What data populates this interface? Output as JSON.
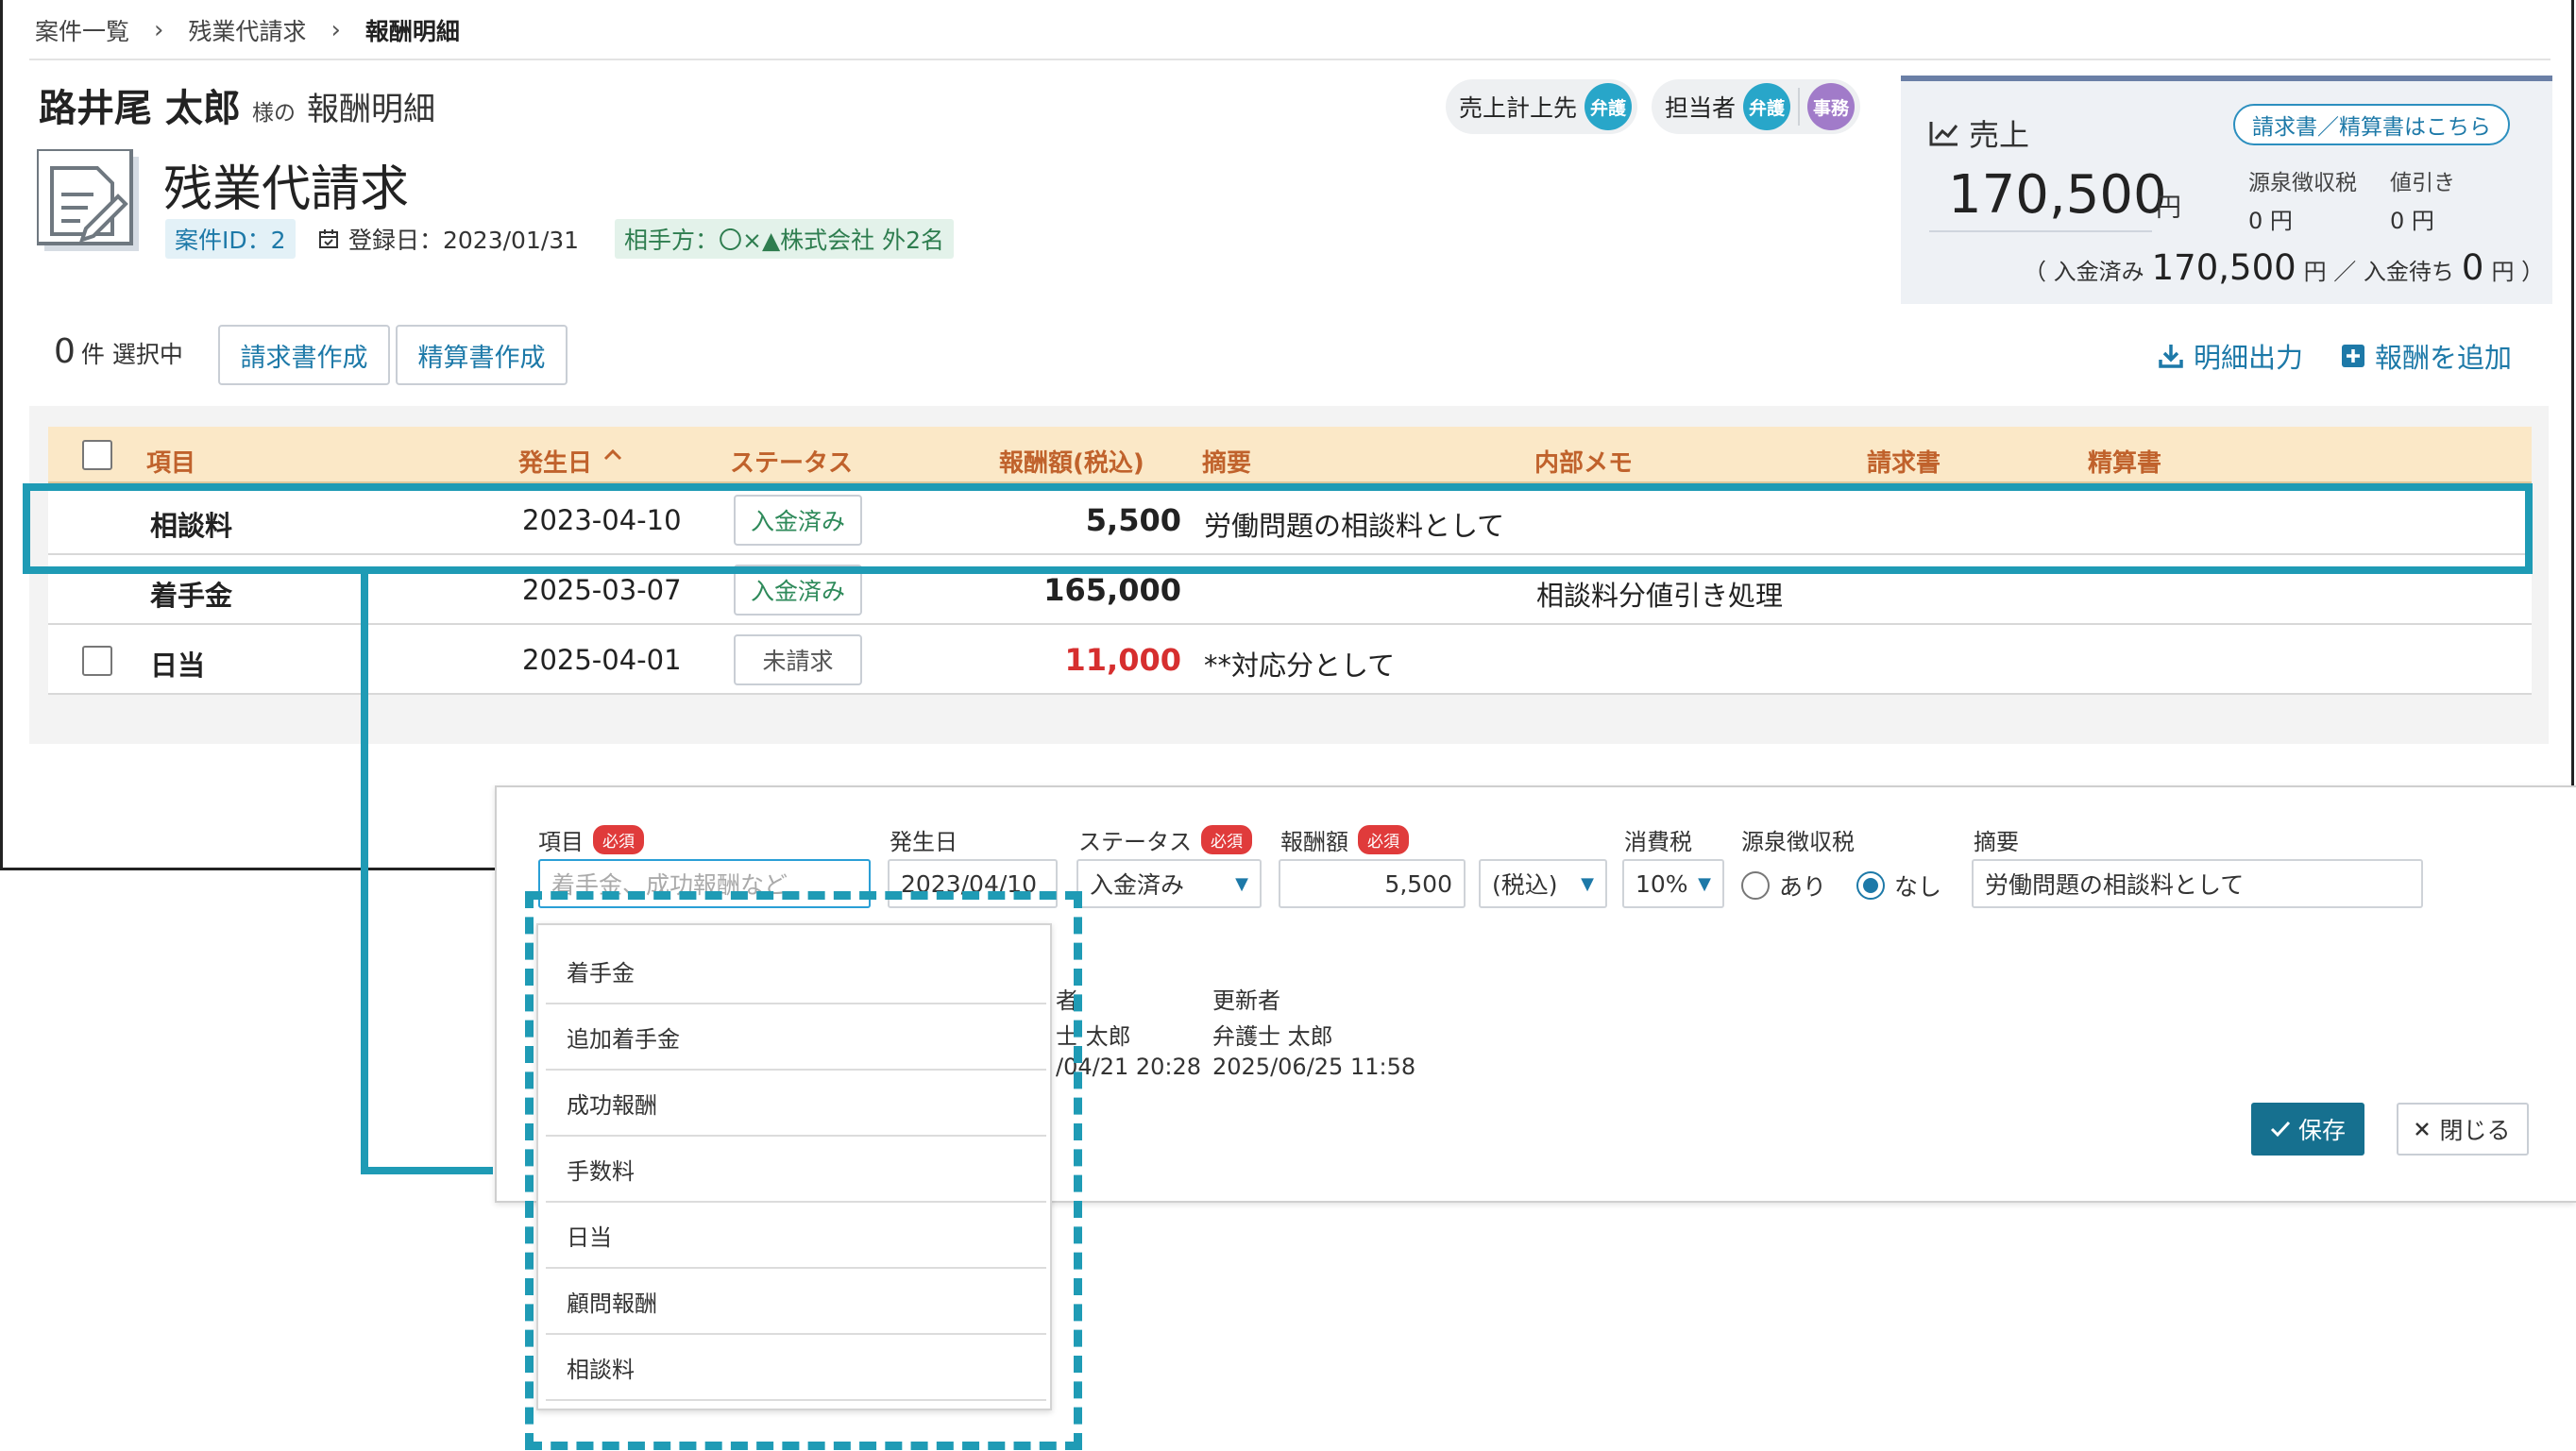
{
  "breadcrumb": [
    "案件一覧",
    "残業代請求",
    "報酬明細"
  ],
  "header": {
    "client_name": "路井尾 太郎",
    "client_sama": "様の",
    "client_suffix": "報酬明細",
    "case_title": "残業代請求",
    "case_id": "案件ID：2",
    "registered": "登録日：2023/01/31",
    "counterparty": "相手方：〇×▲株式会社 外2名"
  },
  "roles": {
    "sales_label": "売上計上先",
    "sales_badge": "弁護",
    "staff_label": "担当者",
    "staff_badges": [
      "弁護",
      "事務"
    ],
    "badge_colors": {
      "lawyer": "#28a6c9",
      "clerk": "#a17bc9"
    }
  },
  "sales": {
    "label": "売上",
    "invoice_link": "請求書／精算書はこちら",
    "amount": "170,500",
    "yen": "円",
    "withholding_label": "源泉徴収税",
    "withholding_value": "0 円",
    "discount_label": "値引き",
    "discount_value": "0 円",
    "paid_prefix": "（ 入金済み",
    "paid_amount": "170,500",
    "paid_mid": "円 ／ 入金待ち",
    "pending_amount": "0",
    "paid_suffix": "円 ）"
  },
  "toolbar": {
    "selected_num": "0",
    "selected_text": "件 選択中",
    "create_invoice": "請求書作成",
    "create_settlement": "精算書作成",
    "export": "明細出力",
    "add_fee": "報酬を追加"
  },
  "table": {
    "headers": {
      "item": "項目",
      "date": "発生日",
      "status": "ステータス",
      "amount": "報酬額(税込)",
      "summary": "摘要",
      "memo": "内部メモ",
      "invoice": "請求書",
      "settlement": "精算書"
    },
    "rows": [
      {
        "item": "相談料",
        "date": "2023-04-10",
        "status": "入金済み",
        "amount": "5,500",
        "summary": "労働問題の相談料として",
        "memo": ""
      },
      {
        "item": "着手金",
        "date": "2025-03-07",
        "status": "入金済み",
        "amount": "165,000",
        "summary": "",
        "memo": "相談料分値引き処理"
      },
      {
        "item": "日当",
        "date": "2025-04-01",
        "status": "未請求",
        "amount": "11,000",
        "summary": "**対応分として",
        "memo": ""
      }
    ]
  },
  "form": {
    "item_label": "項目",
    "required": "必須",
    "item_placeholder": "着手金、成功報酬など",
    "date_label": "発生日",
    "date_value": "2023/04/10",
    "status_label": "ステータス",
    "status_value": "入金済み",
    "amount_label": "報酬額",
    "amount_value": "5,500",
    "tax_incl_value": "(税込)",
    "tax_label": "消費税",
    "tax_value": "10%",
    "withholding_label": "源泉徴収税",
    "withholding_yes": "あり",
    "withholding_no": "なし",
    "summary_label": "摘要",
    "summary_value": "労働問題の相談料として",
    "creator_label": "者",
    "creator_name": "士 太郎",
    "created_at": "/04/21 20:28",
    "updater_label": "更新者",
    "updater_name": "弁護士 太郎",
    "updated_at": "2025/06/25 11:58",
    "save": "保存",
    "close": "閉じる"
  },
  "dropdown": {
    "options": [
      "着手金",
      "追加着手金",
      "成功報酬",
      "手数料",
      "日当",
      "顧問報酬",
      "相談料"
    ]
  }
}
